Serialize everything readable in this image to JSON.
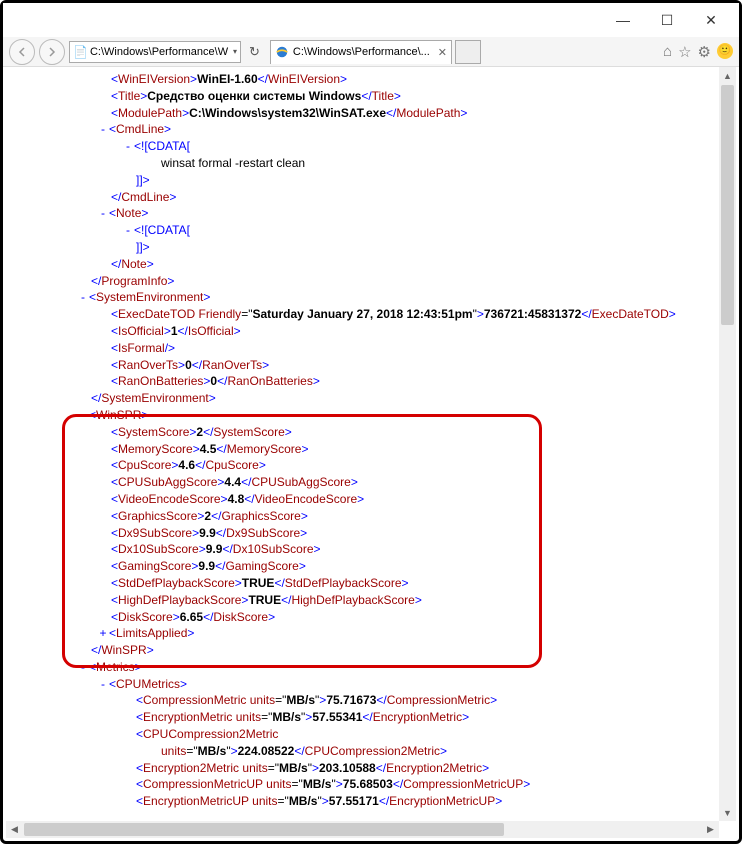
{
  "window": {
    "minimize": "—",
    "maximize": "☐",
    "close": "✕"
  },
  "toolbar": {
    "address": "C:\\Windows\\Performance\\W",
    "tab_title": "C:\\Windows\\Performance\\..."
  },
  "xml": {
    "WinEIVersion": "WinEI-1.60",
    "Title": "Средство оценки системы Windows",
    "ModulePath": "C:\\Windows\\system32\\WinSAT.exe",
    "cdata_open": "<![CDATA[",
    "cdata_close": "]]>",
    "cmd_text": "winsat  formal -restart clean",
    "ExecDateTOD_friendly": "Saturday January 27, 2018 12:43:51pm",
    "ExecDateTOD_value": "736721:45831372",
    "IsOfficial": "1",
    "RanOverTs": "0",
    "RanOnBatteries": "0",
    "WinSPR": {
      "SystemScore": "2",
      "MemoryScore": "4.5",
      "CpuScore": "4.6",
      "CPUSubAggScore": "4.4",
      "VideoEncodeScore": "4.8",
      "GraphicsScore": "2",
      "Dx9SubScore": "9.9",
      "Dx10SubScore": "9.9",
      "GamingScore": "9.9",
      "StdDefPlaybackScore": "TRUE",
      "HighDefPlaybackScore": "TRUE",
      "DiskScore": "6.65"
    },
    "Metrics": {
      "CompressionMetric_units": "MB/s",
      "CompressionMetric": "75.71673",
      "EncryptionMetric_units": "MB/s",
      "EncryptionMetric": "57.55341",
      "CPUCompression2Metric_units": "MB/s",
      "CPUCompression2Metric": "224.08522",
      "Encryption2Metric_units": "MB/s",
      "Encryption2Metric": "203.10588",
      "CompressionMetricUP_units": "MB/s",
      "CompressionMetricUP": "75.68503",
      "EncryptionMetricUP_units": "MB/s",
      "EncryptionMetricUP": "57.55171"
    }
  }
}
